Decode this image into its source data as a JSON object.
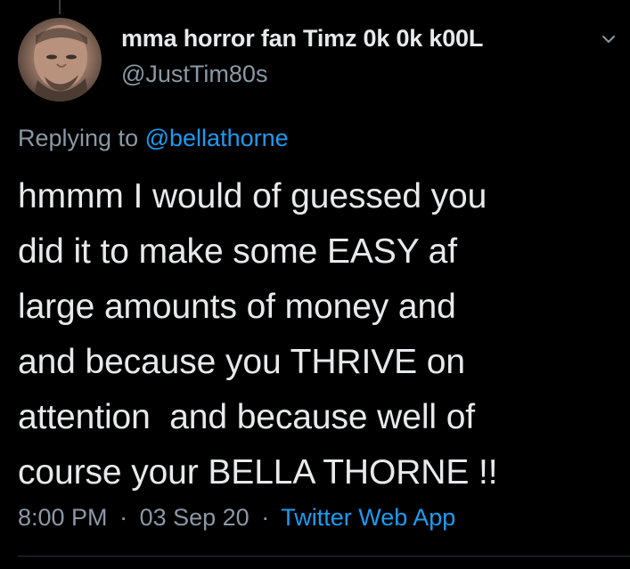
{
  "tweet": {
    "author": {
      "display_name": "mma horror fan Timz 0k 0k k00L",
      "handle": "@JustTim80s"
    },
    "reply_context": {
      "prefix": "Replying to",
      "mention": "@bellathorne"
    },
    "lines": [
      "hmmm I would of guessed you",
      "did it to make some EASY af",
      "large amounts of money and",
      "and because you THRIVE on",
      "attention  and because well of",
      "course your BELLA THORNE !!"
    ],
    "time": "8:00 PM",
    "separator": "·",
    "date": "03 Sep 20",
    "source": "Twitter Web App"
  },
  "icons": {
    "avatar": "profile-photo",
    "menu": "chevron-down-icon"
  },
  "colors": {
    "background": "#000000",
    "text": "#e7e9ea",
    "muted": "#8b98a5",
    "link": "#1d9bf0"
  }
}
